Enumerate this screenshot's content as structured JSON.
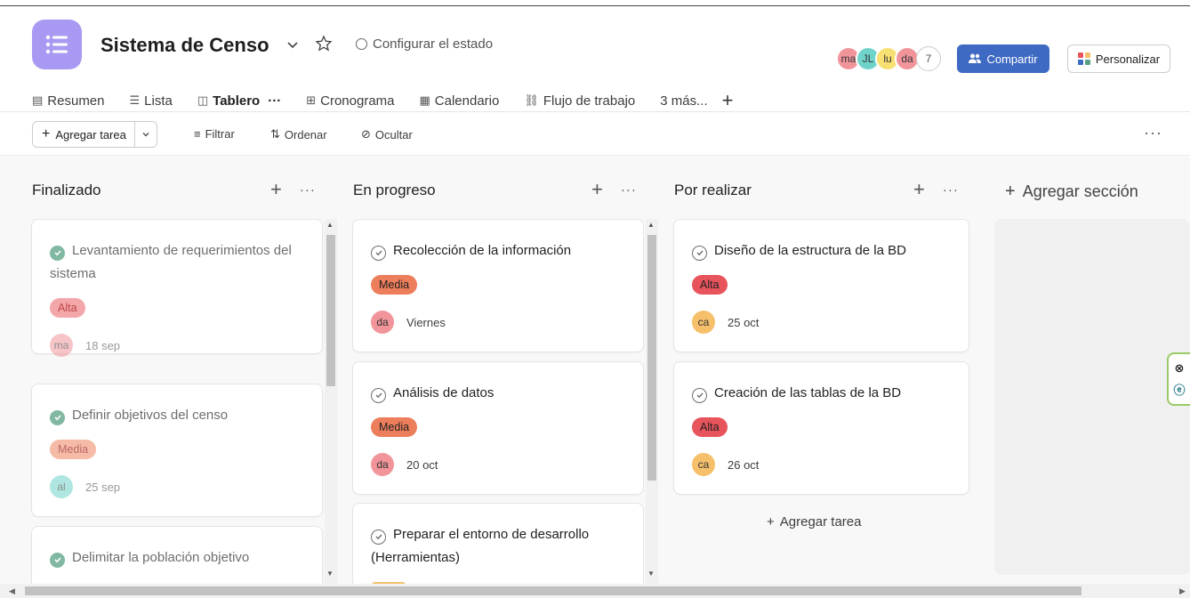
{
  "project": {
    "title": "Sistema de Censo",
    "status_label": "Configurar el estado"
  },
  "members": {
    "avatars": [
      {
        "initials": "ma",
        "color": "#f1959b"
      },
      {
        "initials": "JL",
        "color": "#6fd3c9"
      },
      {
        "initials": "lu",
        "color": "#f7df72"
      },
      {
        "initials": "da",
        "color": "#f1959b"
      }
    ],
    "extra_count": "7"
  },
  "header": {
    "share_label": "Compartir",
    "customize_label": "Personalizar"
  },
  "tabs": [
    {
      "label": "Resumen",
      "icon": "clipboard-icon",
      "glyph": "▤"
    },
    {
      "label": "Lista",
      "icon": "list-icon",
      "glyph": "☰"
    },
    {
      "label": "Tablero",
      "icon": "board-icon",
      "glyph": "◫",
      "active": true,
      "more": "···"
    },
    {
      "label": "Cronograma",
      "icon": "timeline-icon",
      "glyph": "⊞"
    },
    {
      "label": "Calendario",
      "icon": "calendar-icon",
      "glyph": "▦"
    },
    {
      "label": "Flujo de trabajo",
      "icon": "workflow-icon",
      "glyph": "⛓"
    },
    {
      "label": "3 más...",
      "icon": "",
      "glyph": ""
    }
  ],
  "toolbar": {
    "add_task": "Agregar tarea",
    "filter": "Filtrar",
    "sort": "Ordenar",
    "hide": "Ocultar"
  },
  "board": {
    "columns": [
      {
        "title": "Finalizado"
      },
      {
        "title": "En progreso"
      },
      {
        "title": "Por realizar"
      }
    ],
    "add_section": "Agregar sección",
    "add_task_link": "Agregar tarea"
  },
  "cards": {
    "c1": {
      "title": "Levantamiento de requerimientos del sistema",
      "tag": "Alta",
      "assignee": "ma",
      "date": "18 sep"
    },
    "c2": {
      "title": "Definir objetivos del censo",
      "tag": "Media",
      "assignee": "al",
      "date": "25 sep"
    },
    "c3": {
      "title": "Delimitar la población objetivo"
    },
    "c4": {
      "title": "Recolección de la información",
      "tag": "Media",
      "assignee": "da",
      "date": "Viernes"
    },
    "c5": {
      "title": "Análisis de datos",
      "tag": "Media",
      "assignee": "da",
      "date": "20 oct"
    },
    "c6": {
      "title": "Preparar el entorno de desarrollo (Herramientas)"
    },
    "c7": {
      "title": "Diseño de la estructura de la BD",
      "tag": "Alta",
      "assignee": "ca",
      "date": "25 oct"
    },
    "c8": {
      "title": "Creación de las tablas de la BD",
      "tag": "Alta",
      "assignee": "ca",
      "date": "26 oct"
    }
  },
  "colors": {
    "accent": "#3f6ac4",
    "app_icon": "#a999f2",
    "tag_alta": "#e8545c",
    "tag_media": "#ec7e5b",
    "avatar_da": "#f1959b",
    "avatar_ca": "#f6c06b",
    "avatar_al": "#6fd3c9",
    "check_done": "#58a182"
  }
}
